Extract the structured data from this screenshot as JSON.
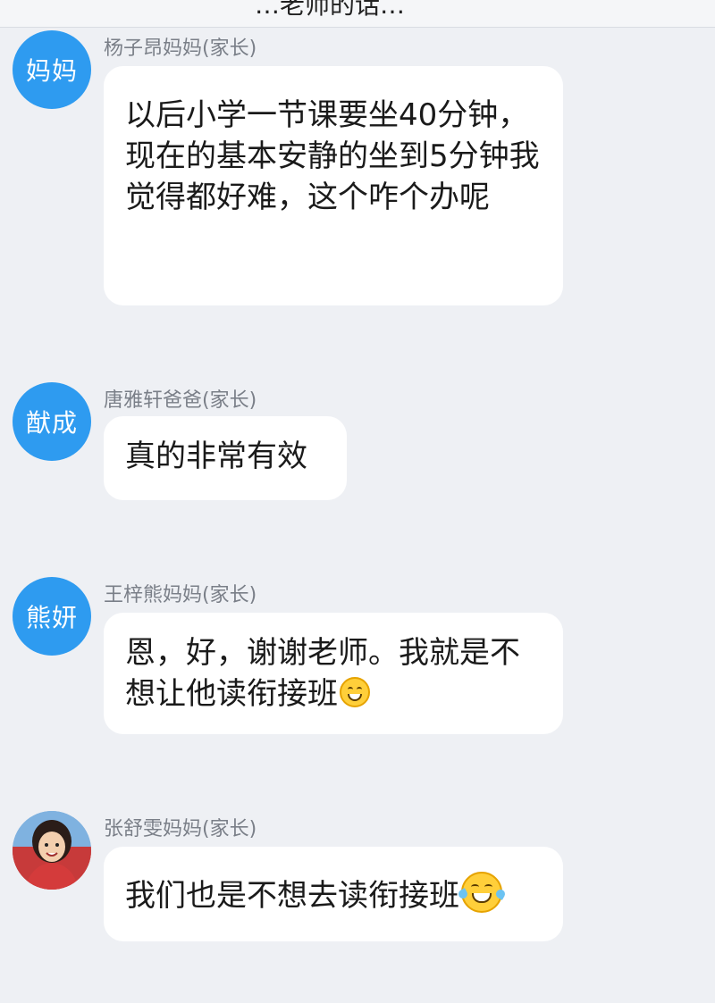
{
  "header": {
    "cut_title": "…老师的话…"
  },
  "messages": [
    {
      "avatar_text": "妈妈",
      "sender": "杨子昂妈妈(家长)",
      "text": "以后小学一节课要坐40分钟，现在的基本安静的坐到5分钟我觉得都好难，这个咋个办呢",
      "emoji": ""
    },
    {
      "avatar_text": "猷成",
      "sender": "唐雅轩爸爸(家长)",
      "text": "真的非常有效",
      "emoji": ""
    },
    {
      "avatar_text": "熊妍",
      "sender": "王梓熊妈妈(家长)",
      "text": "恩，好，谢谢老师。我就是不想让他读衔接班",
      "emoji": "grinning-face-icon"
    },
    {
      "avatar_text": "",
      "sender": "张舒雯妈妈(家长)",
      "text": "我们也是不想去读衔接班",
      "emoji": "tears-of-joy-icon"
    }
  ],
  "colors": {
    "background": "#eef0f4",
    "avatar": "#2e9bf0",
    "bubble": "#ffffff",
    "sender_text": "#7a7f88"
  }
}
